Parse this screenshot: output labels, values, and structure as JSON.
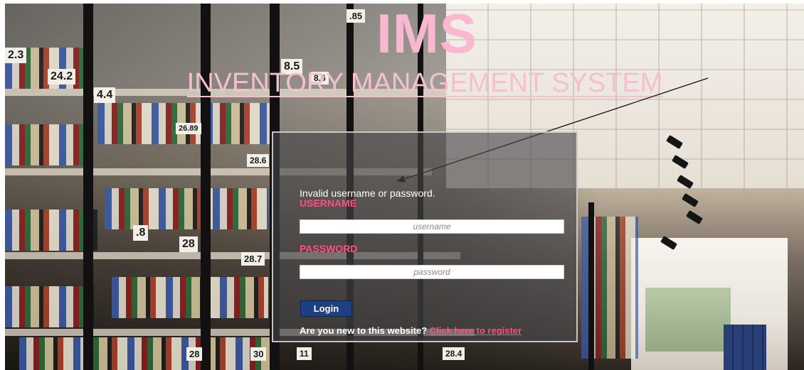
{
  "header": {
    "logo_text": "IMS",
    "subtitle": "INVENTORY MANAGEMENT SYSTEM"
  },
  "login": {
    "error_message": "Invalid username or password.",
    "username_label": "USERNAME",
    "username_placeholder": "username",
    "password_label": "PASSWORD",
    "password_placeholder": "password",
    "login_button": "Login",
    "register_prompt": "Are you new to this website?",
    "register_link": "Click here to register"
  },
  "shelf_labels": [
    "2.3",
    "24.2",
    "4.4",
    "26.89",
    "28.6",
    "8.5",
    "8.6",
    ".8",
    "28",
    "28.7",
    "28",
    "30",
    "11",
    ".85",
    "28.4"
  ],
  "colors": {
    "accent_pink": "#ff4f84",
    "title_pink": "#f8b8cf",
    "button_blue": "#1f3f84",
    "panel_overlay": "rgba(70,70,72,0.62)"
  }
}
